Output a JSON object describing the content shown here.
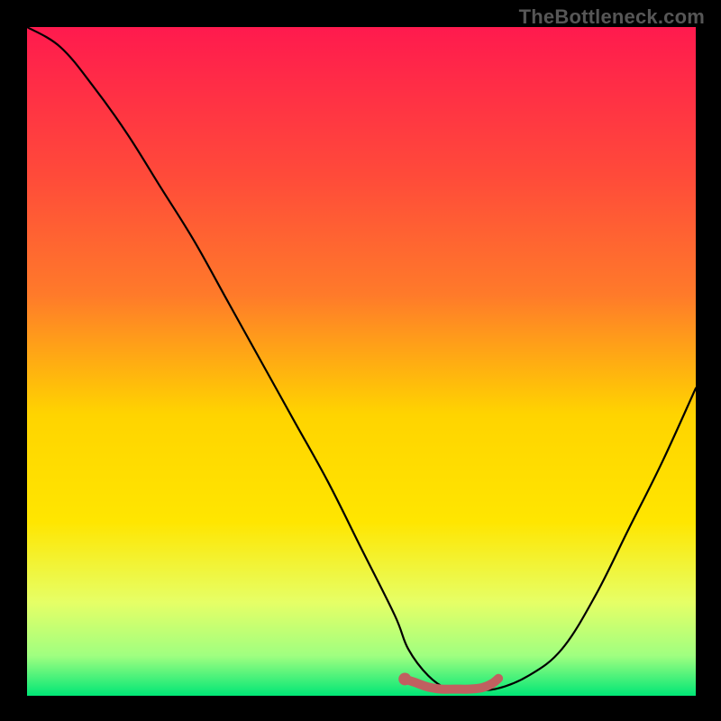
{
  "watermark": "TheBottleneck.com",
  "chart_data": {
    "type": "line",
    "title": "",
    "xlabel": "",
    "ylabel": "",
    "xlim": [
      0,
      100
    ],
    "ylim": [
      0,
      100
    ],
    "grid": false,
    "legend": false,
    "background_gradient": {
      "top": "#ff1a4e",
      "upper_mid": "#ff7a2a",
      "mid": "#ffe600",
      "lower_mid": "#e6ff66",
      "near_bottom": "#a0ff80",
      "bottom": "#00e676"
    },
    "series": [
      {
        "name": "bottleneck-curve",
        "color": "#000000",
        "x": [
          0,
          5,
          10,
          15,
          20,
          25,
          30,
          35,
          40,
          45,
          50,
          55,
          57,
          60,
          63,
          66,
          70,
          75,
          80,
          85,
          90,
          95,
          100
        ],
        "y": [
          100,
          97,
          91,
          84,
          76,
          68,
          59,
          50,
          41,
          32,
          22,
          12,
          7,
          3,
          1,
          1,
          1,
          3,
          7,
          15,
          25,
          35,
          46
        ]
      },
      {
        "name": "optimal-range-highlight",
        "color": "#c06060",
        "marker": "dot",
        "x": [
          56.5,
          58,
          60,
          62,
          64,
          66,
          68,
          69.5,
          70.5
        ],
        "y": [
          2.5,
          2,
          1.3,
          1,
          1,
          1,
          1.2,
          1.8,
          2.6
        ]
      }
    ],
    "annotations": []
  }
}
